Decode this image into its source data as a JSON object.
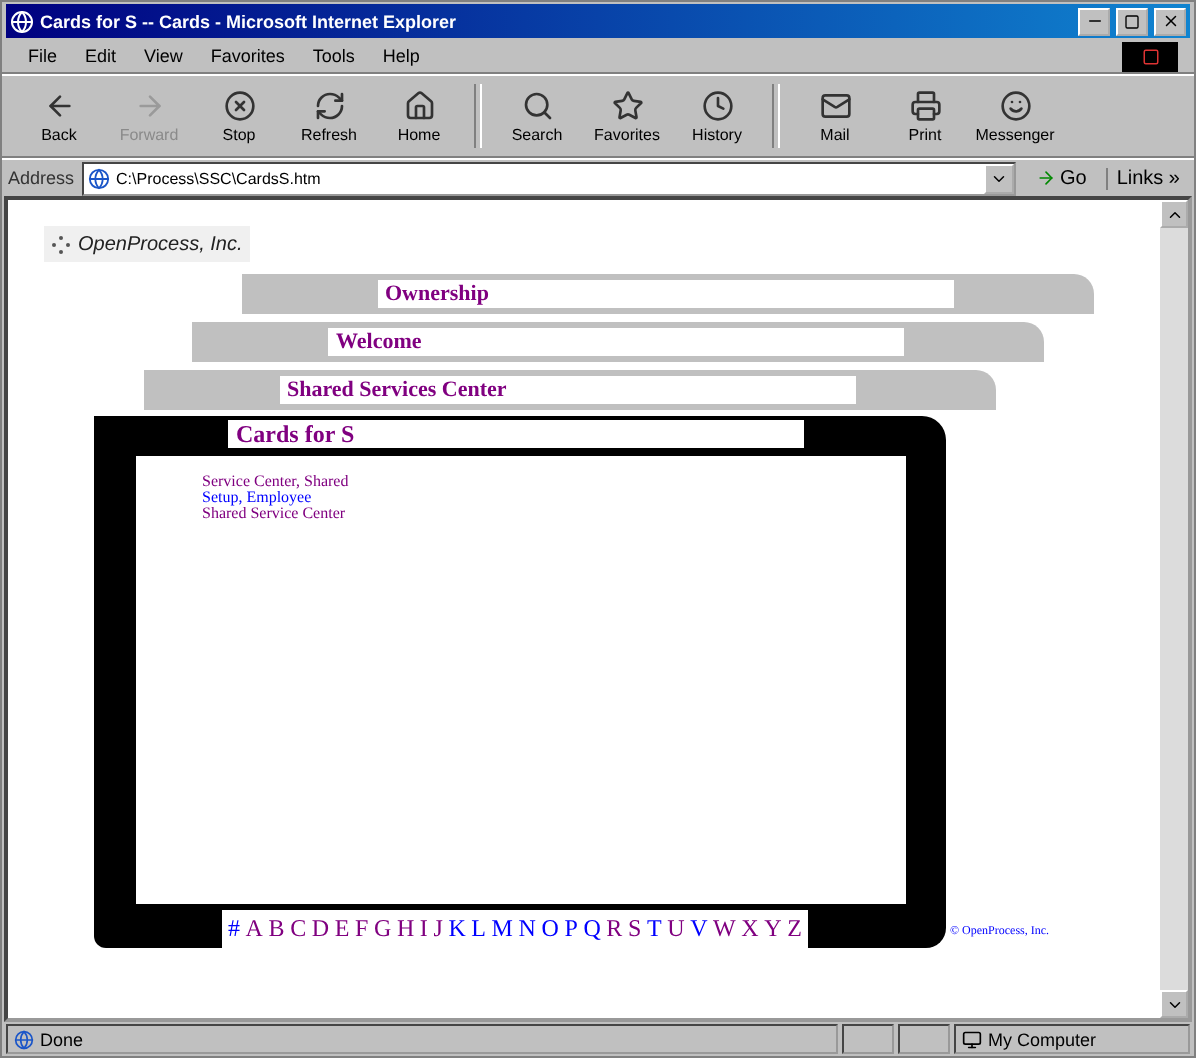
{
  "window": {
    "title": "Cards for S -- Cards - Microsoft Internet Explorer"
  },
  "menu": [
    "File",
    "Edit",
    "View",
    "Favorites",
    "Tools",
    "Help"
  ],
  "toolbar": [
    {
      "label": "Back",
      "disabled": false
    },
    {
      "label": "Forward",
      "disabled": true
    },
    {
      "label": "Stop",
      "disabled": false
    },
    {
      "label": "Refresh",
      "disabled": false
    },
    {
      "label": "Home",
      "disabled": false
    },
    {
      "label": "Search",
      "disabled": false
    },
    {
      "label": "Favorites",
      "disabled": false
    },
    {
      "label": "History",
      "disabled": false
    },
    {
      "label": "Mail",
      "disabled": false
    },
    {
      "label": "Print",
      "disabled": false
    },
    {
      "label": "Messenger",
      "disabled": false
    }
  ],
  "address_bar": {
    "label": "Address",
    "value": "C:\\Process\\SSC\\CardsS.htm",
    "go": "Go",
    "links": "Links »"
  },
  "page": {
    "logo": "OpenProcess, Inc.",
    "tabs": [
      "Ownership",
      "Welcome",
      "Shared Services Center"
    ],
    "card": {
      "title": "Cards for S",
      "links": [
        {
          "text": "Service Center, Shared",
          "visited": true
        },
        {
          "text": "Setup, Employee",
          "visited": false
        },
        {
          "text": "Shared Service Center",
          "visited": true
        }
      ],
      "alphabet": [
        {
          "text": "#",
          "visited": false
        },
        {
          "text": "A",
          "visited": true
        },
        {
          "text": "B",
          "visited": true
        },
        {
          "text": "C",
          "visited": true
        },
        {
          "text": "D",
          "visited": true
        },
        {
          "text": "E",
          "visited": true
        },
        {
          "text": "F",
          "visited": true
        },
        {
          "text": "G",
          "visited": true
        },
        {
          "text": "H",
          "visited": true
        },
        {
          "text": "I",
          "visited": true
        },
        {
          "text": "J",
          "visited": true
        },
        {
          "text": "K",
          "visited": false
        },
        {
          "text": "L",
          "visited": false
        },
        {
          "text": "M",
          "visited": false
        },
        {
          "text": "N",
          "visited": false
        },
        {
          "text": "O",
          "visited": false
        },
        {
          "text": "P",
          "visited": false
        },
        {
          "text": "Q",
          "visited": false
        },
        {
          "text": "R",
          "visited": true
        },
        {
          "text": "S",
          "visited": true
        },
        {
          "text": "T",
          "visited": false
        },
        {
          "text": "U",
          "visited": true
        },
        {
          "text": "V",
          "visited": false
        },
        {
          "text": "W",
          "visited": true
        },
        {
          "text": "X",
          "visited": true
        },
        {
          "text": "Y",
          "visited": true
        },
        {
          "text": "Z",
          "visited": true
        }
      ]
    },
    "copyright": "© OpenProcess, Inc."
  },
  "status_bar": {
    "text": "Done",
    "zone": "My Computer"
  }
}
